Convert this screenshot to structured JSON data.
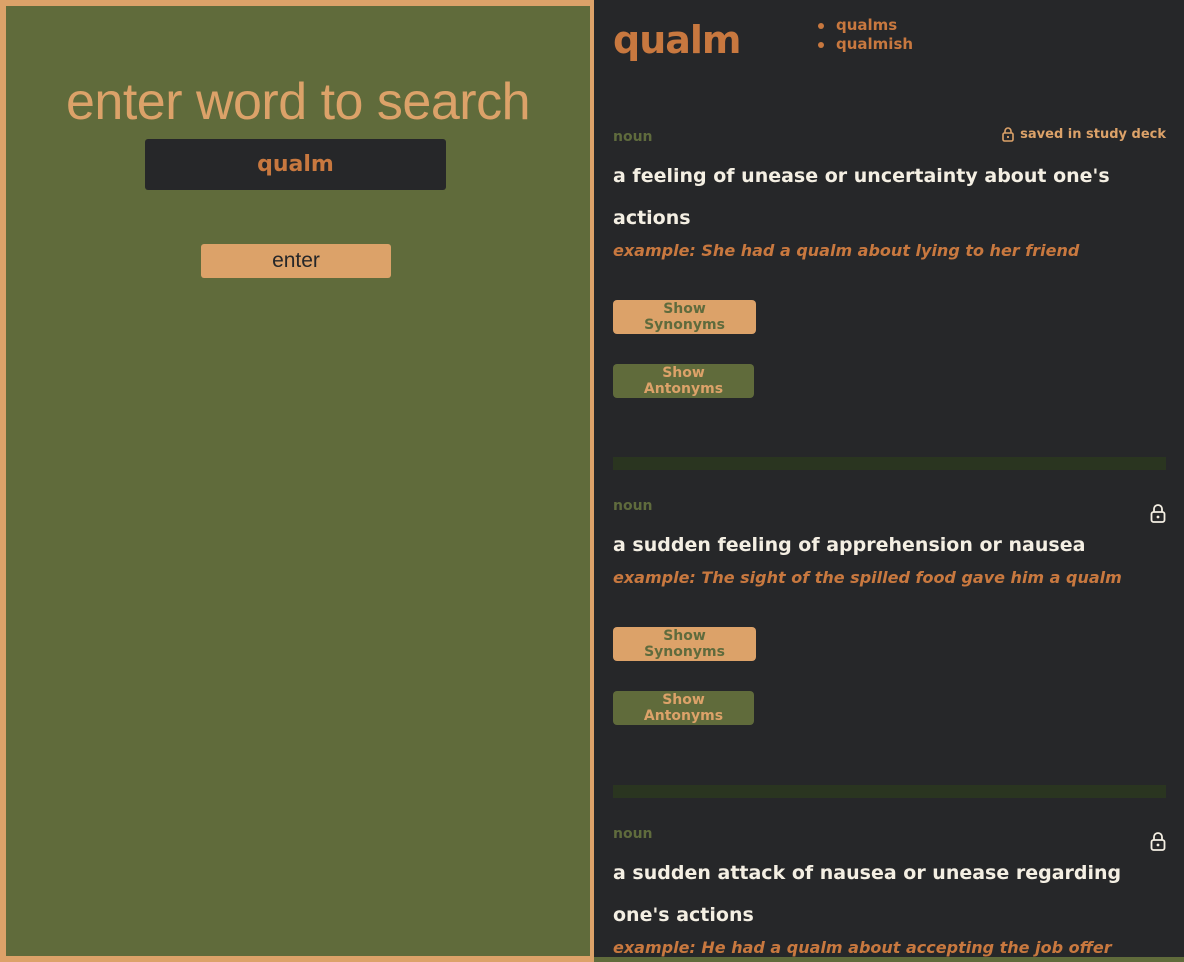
{
  "search": {
    "title": "enter word to search",
    "value": "qualm",
    "enter_label": "enter"
  },
  "result": {
    "word": "qualm",
    "related": [
      "qualms",
      "qualmish"
    ],
    "definitions": [
      {
        "pos": "noun",
        "lock_label": "saved in study deck",
        "locked": true,
        "text": "a feeling of unease or uncertainty about one's actions",
        "example": "example: She had a qualm about lying to her friend",
        "synonyms_label": "Show Synonyms",
        "antonyms_label": "Show Antonyms"
      },
      {
        "pos": "noun",
        "lock_label": "",
        "locked": false,
        "text": "a sudden feeling of apprehension or nausea",
        "example": "example: The sight of the spilled food gave him a qualm",
        "synonyms_label": "Show Synonyms",
        "antonyms_label": "Show Antonyms"
      },
      {
        "pos": "noun",
        "lock_label": "",
        "locked": false,
        "text": "a sudden attack of nausea or unease regarding one's actions",
        "example": "example: He had a qualm about accepting the job offer"
      }
    ]
  },
  "colors": {
    "panel_green": "#606b3b",
    "accent_tan": "#dca269",
    "accent_orange": "#c8783f",
    "dark_bg": "#262729",
    "divider": "#2a3520"
  }
}
